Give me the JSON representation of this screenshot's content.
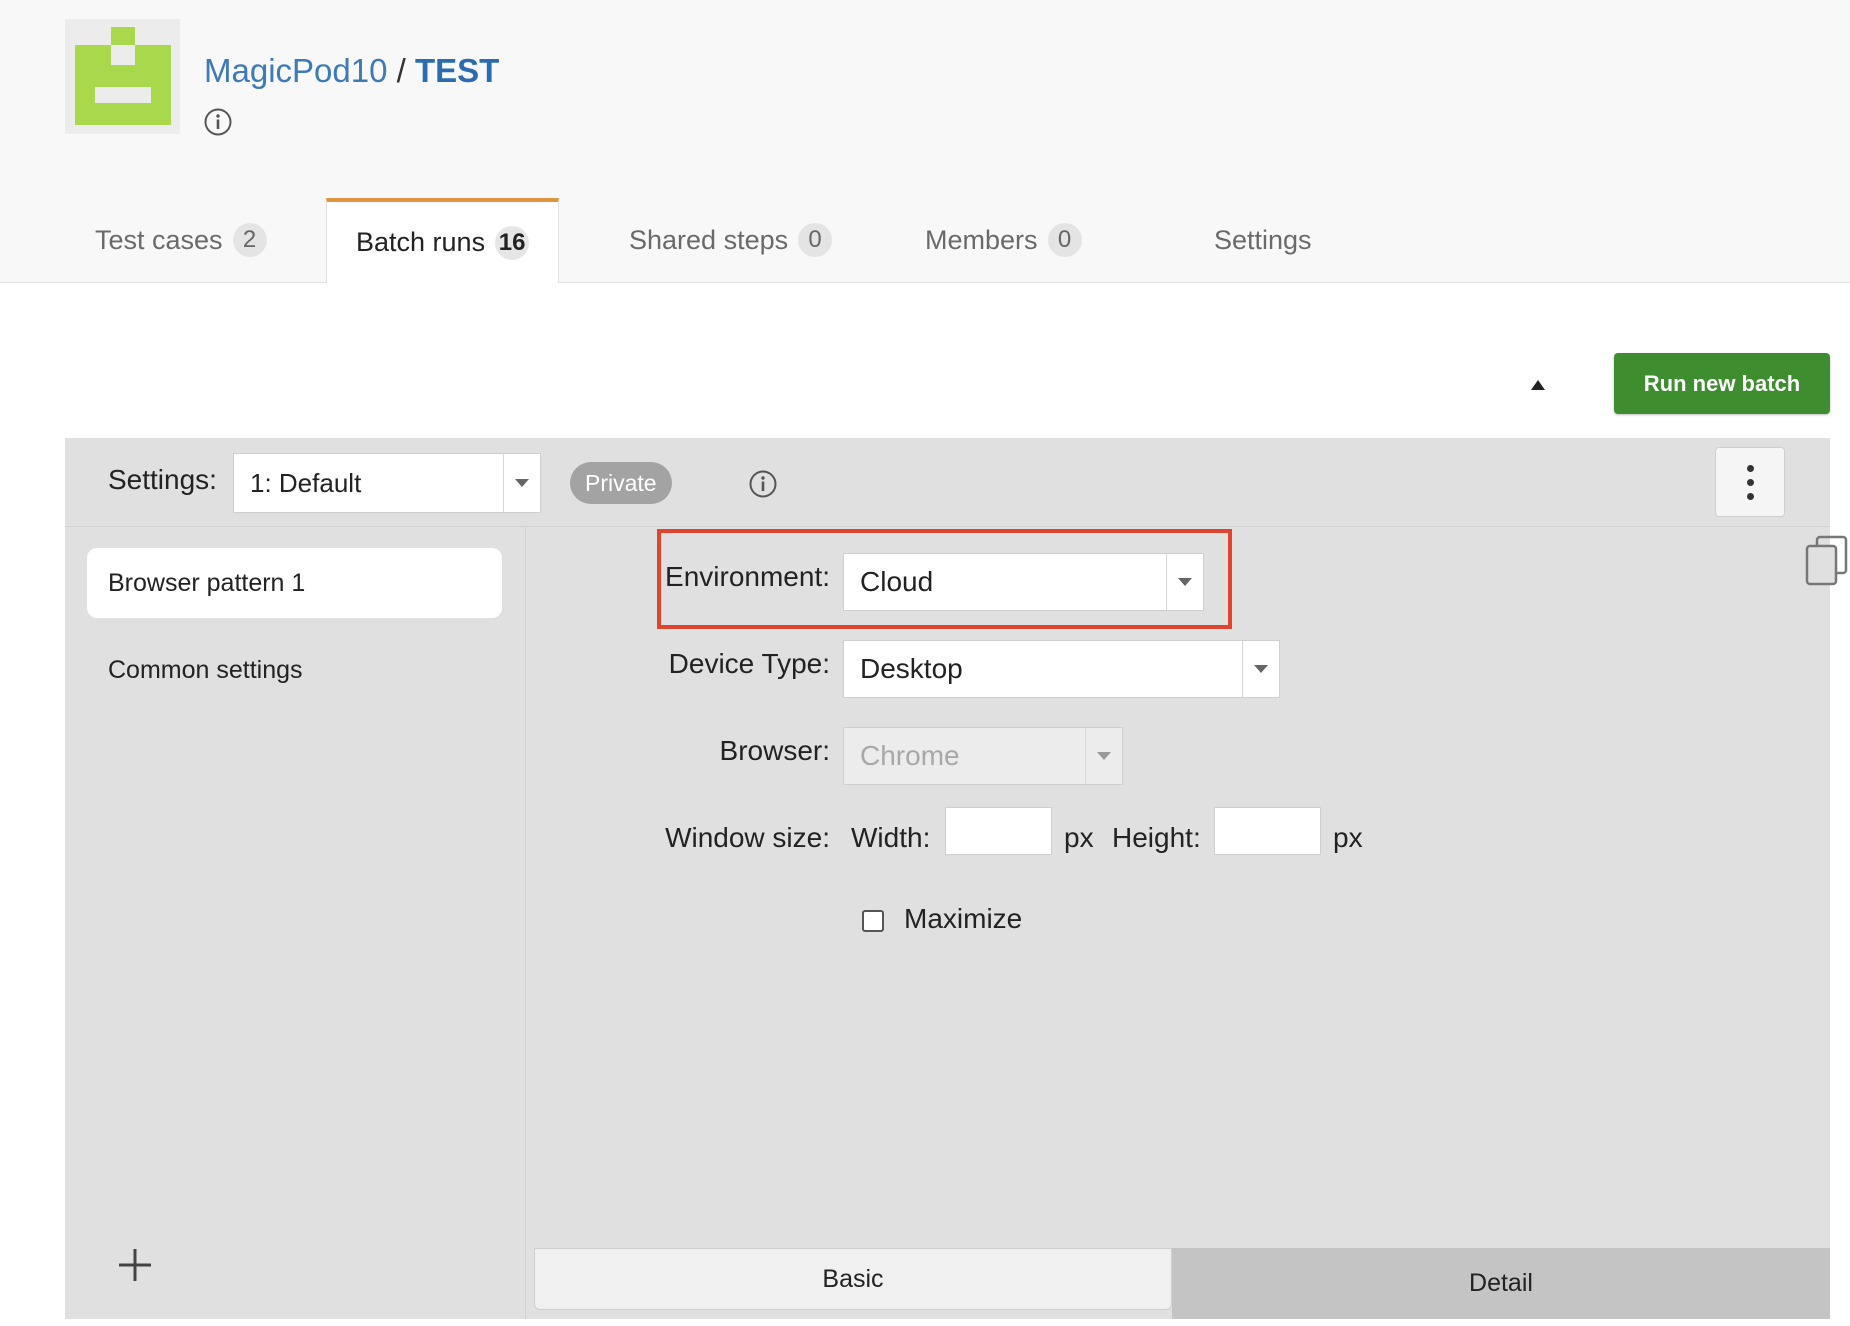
{
  "header": {
    "org_name": "MagicPod10",
    "separator": "/",
    "project_name": "TEST"
  },
  "tabs": [
    {
      "label": "Test cases",
      "count": "2"
    },
    {
      "label": "Batch runs",
      "count": "16",
      "active": true
    },
    {
      "label": "Shared steps",
      "count": "0"
    },
    {
      "label": "Members",
      "count": "0"
    },
    {
      "label": "Settings"
    }
  ],
  "toolbar": {
    "run_new_batch_label": "Run new batch"
  },
  "settings_bar": {
    "label": "Settings:",
    "selected": "1: Default",
    "badge": "Private"
  },
  "sidebar": {
    "items": [
      {
        "label": "Browser pattern 1",
        "active": true
      },
      {
        "label": "Common settings"
      }
    ]
  },
  "form": {
    "environment": {
      "label": "Environment:",
      "value": "Cloud"
    },
    "device_type": {
      "label": "Device Type:",
      "value": "Desktop"
    },
    "browser": {
      "label": "Browser:",
      "value": "Chrome"
    },
    "window_size": {
      "label": "Window size:",
      "width_label": "Width:",
      "width_value": "",
      "height_label": "Height:",
      "height_value": "",
      "unit": "px"
    },
    "maximize_label": "Maximize"
  },
  "bottom_tabs": {
    "basic": "Basic",
    "detail": "Detail"
  },
  "colors": {
    "accent_tab": "#e39441",
    "primary_button": "#3e8d2f",
    "highlight": "#e0442f",
    "link": "#3d7ab8"
  }
}
